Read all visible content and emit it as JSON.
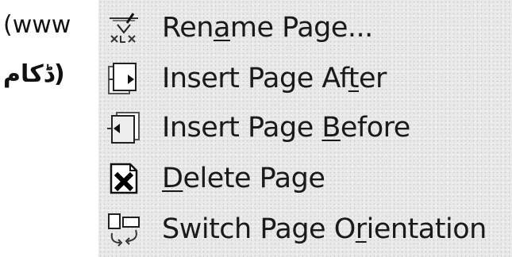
{
  "left_text": {
    "line1": "(www",
    "line2": "(ڈکام"
  },
  "menu": {
    "items": [
      {
        "pre": "Ren",
        "mn": "a",
        "post": "me Page...",
        "icon": "rename-page-icon"
      },
      {
        "pre": "Insert Page Af",
        "mn": "t",
        "post": "er",
        "icon": "insert-page-after-icon"
      },
      {
        "pre": "Insert Page ",
        "mn": "B",
        "post": "efore",
        "icon": "insert-page-before-icon"
      },
      {
        "pre": "",
        "mn": "D",
        "post": "elete Page",
        "icon": "delete-page-icon"
      },
      {
        "pre": "Switch Page O",
        "mn": "r",
        "post": "ientation",
        "icon": "switch-orientation-icon"
      }
    ]
  }
}
